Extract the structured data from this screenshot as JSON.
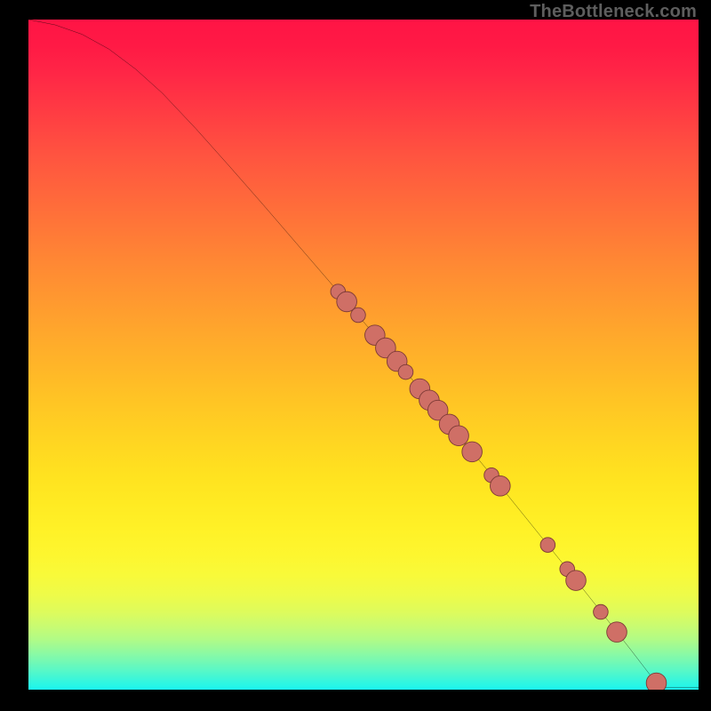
{
  "attribution": "TheBottleneck.com",
  "colors": {
    "marker_fill": "#cf6f66",
    "marker_stroke": "#7d3a36",
    "curve_stroke": "#000000"
  },
  "chart_data": {
    "type": "line",
    "title": "",
    "xlabel": "",
    "ylabel": "",
    "xlim": [
      0,
      100
    ],
    "ylim": [
      0,
      100
    ],
    "grid": false,
    "curve": [
      {
        "x": 0,
        "y": 100.0
      },
      {
        "x": 4,
        "y": 99.2
      },
      {
        "x": 8,
        "y": 97.8
      },
      {
        "x": 12,
        "y": 95.6
      },
      {
        "x": 16,
        "y": 92.6
      },
      {
        "x": 20,
        "y": 89.0
      },
      {
        "x": 25,
        "y": 83.7
      },
      {
        "x": 30,
        "y": 78.1
      },
      {
        "x": 35,
        "y": 72.4
      },
      {
        "x": 40,
        "y": 66.6
      },
      {
        "x": 45,
        "y": 60.8
      },
      {
        "x": 50,
        "y": 54.9
      },
      {
        "x": 55,
        "y": 49.0
      },
      {
        "x": 60,
        "y": 43.0
      },
      {
        "x": 65,
        "y": 37.0
      },
      {
        "x": 70,
        "y": 30.9
      },
      {
        "x": 75,
        "y": 24.7
      },
      {
        "x": 80,
        "y": 18.5
      },
      {
        "x": 85,
        "y": 12.2
      },
      {
        "x": 90,
        "y": 5.8
      },
      {
        "x": 93,
        "y": 1.9
      },
      {
        "x": 94.3,
        "y": 0.3
      },
      {
        "x": 100,
        "y": 0.3
      }
    ],
    "marker_radius_small": 1.1,
    "marker_radius_large": 1.5,
    "markers": [
      {
        "x": 46.2,
        "y": 59.4,
        "r": "small"
      },
      {
        "x": 47.5,
        "y": 57.9,
        "r": "large"
      },
      {
        "x": 49.2,
        "y": 55.9,
        "r": "small"
      },
      {
        "x": 51.7,
        "y": 52.9,
        "r": "large"
      },
      {
        "x": 53.3,
        "y": 51.0,
        "r": "large"
      },
      {
        "x": 55.0,
        "y": 49.0,
        "r": "large"
      },
      {
        "x": 56.3,
        "y": 47.4,
        "r": "small"
      },
      {
        "x": 58.4,
        "y": 44.9,
        "r": "large"
      },
      {
        "x": 59.8,
        "y": 43.2,
        "r": "large"
      },
      {
        "x": 61.1,
        "y": 41.7,
        "r": "large"
      },
      {
        "x": 62.8,
        "y": 39.6,
        "r": "large"
      },
      {
        "x": 64.2,
        "y": 37.9,
        "r": "large"
      },
      {
        "x": 66.2,
        "y": 35.5,
        "r": "large"
      },
      {
        "x": 69.1,
        "y": 32.0,
        "r": "small"
      },
      {
        "x": 70.4,
        "y": 30.4,
        "r": "large"
      },
      {
        "x": 77.5,
        "y": 21.6,
        "r": "small"
      },
      {
        "x": 80.4,
        "y": 18.0,
        "r": "small"
      },
      {
        "x": 81.7,
        "y": 16.3,
        "r": "large"
      },
      {
        "x": 85.4,
        "y": 11.6,
        "r": "small"
      },
      {
        "x": 87.8,
        "y": 8.6,
        "r": "large"
      },
      {
        "x": 93.7,
        "y": 1.0,
        "r": "large"
      }
    ]
  }
}
